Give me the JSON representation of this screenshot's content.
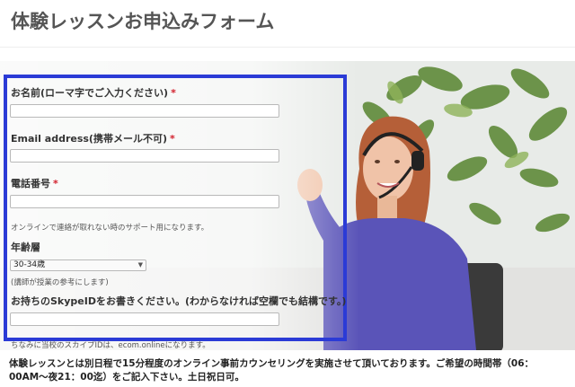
{
  "page": {
    "title": "体験レッスンお申込みフォーム"
  },
  "form": {
    "name_label": "お名前(ローマ字でご入力ください)",
    "email_label": "Email address(携帯メール不可)",
    "phone_label": "電話番号",
    "phone_hint": "オンラインで連絡が取れない時のサポート用になります。",
    "age_label": "年齢層",
    "age_selected": "30-34歳",
    "age_hint": "(講師が授業の参考にします)",
    "skype_label": "お持ちのSkypeIDをお書きください。(わからなければ空欄でも結構です。)",
    "skype_hint": "ちなみに当校のスカイプIDは、ecom.onlineになります。",
    "required_mark": "*"
  },
  "footer": {
    "note": "体験レッスンとは別日程で15分程度のオンライン事前カウンセリングを実施させて頂いております。ご希望の時間帯（06：00AM〜夜21：00迄）をご記入下さい。土日祝日可。"
  },
  "colors": {
    "highlight": "#2b3bd6",
    "required": "#d21f2b",
    "shirt": "#5a54b8"
  }
}
